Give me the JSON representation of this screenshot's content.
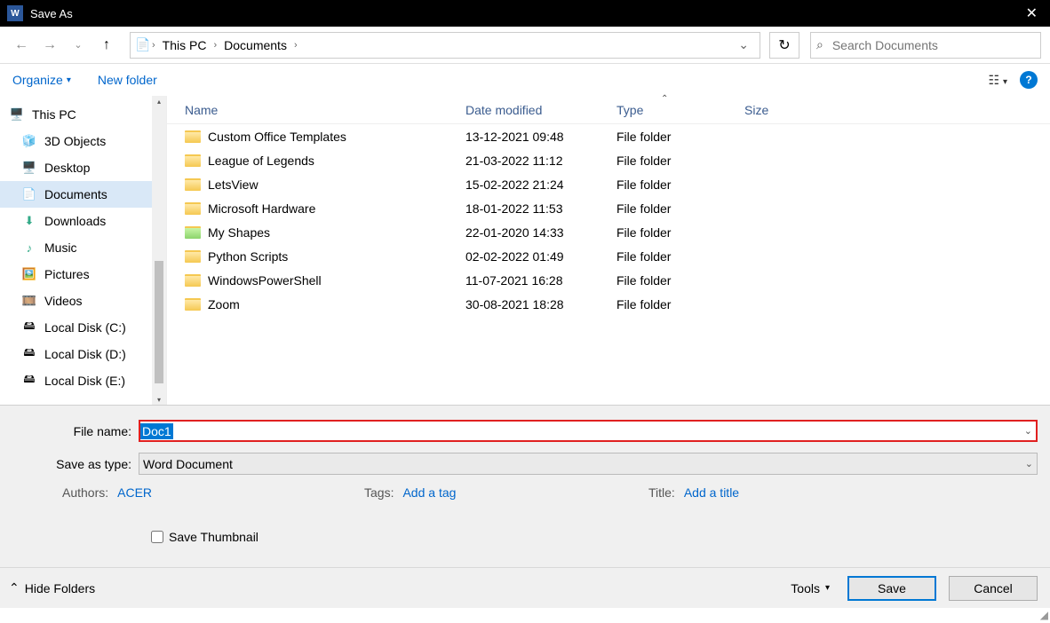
{
  "window": {
    "title": "Save As"
  },
  "breadcrumb": {
    "root": "This PC",
    "folder": "Documents"
  },
  "search": {
    "placeholder": "Search Documents"
  },
  "toolbar": {
    "organize": "Organize",
    "new_folder": "New folder"
  },
  "columns": {
    "name": "Name",
    "date": "Date modified",
    "type": "Type",
    "size": "Size"
  },
  "nav": {
    "this_pc": "This PC",
    "objects3d": "3D Objects",
    "desktop": "Desktop",
    "documents": "Documents",
    "downloads": "Downloads",
    "music": "Music",
    "pictures": "Pictures",
    "videos": "Videos",
    "disk_c": "Local Disk (C:)",
    "disk_d": "Local Disk (D:)",
    "disk_e": "Local Disk (E:)"
  },
  "files": [
    {
      "name": "Custom Office Templates",
      "date": "13-12-2021 09:48",
      "type": "File folder",
      "special": false
    },
    {
      "name": "League of Legends",
      "date": "21-03-2022 11:12",
      "type": "File folder",
      "special": false
    },
    {
      "name": "LetsView",
      "date": "15-02-2022 21:24",
      "type": "File folder",
      "special": false
    },
    {
      "name": "Microsoft Hardware",
      "date": "18-01-2022 11:53",
      "type": "File folder",
      "special": false
    },
    {
      "name": "My Shapes",
      "date": "22-01-2020 14:33",
      "type": "File folder",
      "special": true
    },
    {
      "name": "Python Scripts",
      "date": "02-02-2022 01:49",
      "type": "File folder",
      "special": false
    },
    {
      "name": "WindowsPowerShell",
      "date": "11-07-2021 16:28",
      "type": "File folder",
      "special": false
    },
    {
      "name": "Zoom",
      "date": "30-08-2021 18:28",
      "type": "File folder",
      "special": false
    }
  ],
  "form": {
    "file_name_label": "File name:",
    "file_name_value": "Doc1",
    "save_type_label": "Save as type:",
    "save_type_value": "Word Document",
    "authors_label": "Authors:",
    "authors_value": "ACER",
    "tags_label": "Tags:",
    "tags_value": "Add a tag",
    "title_label": "Title:",
    "title_value": "Add a title",
    "thumbnail_label": "Save Thumbnail"
  },
  "footer": {
    "hide_folders": "Hide Folders",
    "tools": "Tools",
    "save": "Save",
    "cancel": "Cancel"
  }
}
